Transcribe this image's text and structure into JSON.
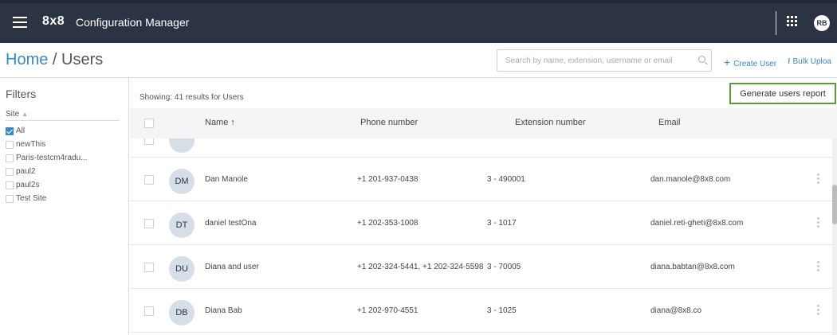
{
  "topbar": {
    "logo": "8x8",
    "title": "Configuration Manager",
    "user_initials": "RB"
  },
  "header": {
    "breadcrumb_home": "Home",
    "breadcrumb_sep": " / ",
    "breadcrumb_page": "Users",
    "search_placeholder": "Search by name, extension, username or email",
    "create_user": "Create User",
    "bulk_upload": "Bulk Uploa"
  },
  "filters": {
    "title": "Filters",
    "site_label": "Site",
    "sites": [
      {
        "label": "All",
        "checked": true
      },
      {
        "label": "newThis",
        "checked": false
      },
      {
        "label": "Paris-testcm4radu...",
        "checked": false
      },
      {
        "label": "paul2",
        "checked": false
      },
      {
        "label": "paul2s",
        "checked": false
      },
      {
        "label": "Test Site",
        "checked": false
      }
    ]
  },
  "main": {
    "showing": "Showing: 41 results for Users",
    "report_button": "Generate users report",
    "columns": {
      "name": "Name ↑",
      "phone": "Phone number",
      "extension": "Extension number",
      "email": "Email"
    },
    "rows": [
      {
        "initials": "DM",
        "name": "Dan Manole",
        "phone": "+1 201-937-0438",
        "extension": "3 - 490001",
        "email": "dan.manole@8x8.com"
      },
      {
        "initials": "DT",
        "name": "daniel testOna",
        "phone": "+1 202-353-1008",
        "extension": "3 - 1017",
        "email": "daniel.reti-gheti@8x8.com"
      },
      {
        "initials": "DU",
        "name": "Diana and user",
        "phone": "+1 202-324-5441, +1 202-324-5598",
        "extension": "3 - 70005",
        "email": "diana.babtan@8x8.com"
      },
      {
        "initials": "DB",
        "name": "Diana Bab",
        "phone": "+1 202-970-4551",
        "extension": "3 - 1025",
        "email": "diana@8x8.co"
      }
    ]
  },
  "colors": {
    "topbar_bg": "#2c3443",
    "accent_blue": "#3a87c7",
    "report_border": "#5b9b3a",
    "avatar_bg": "#d6dee7"
  }
}
